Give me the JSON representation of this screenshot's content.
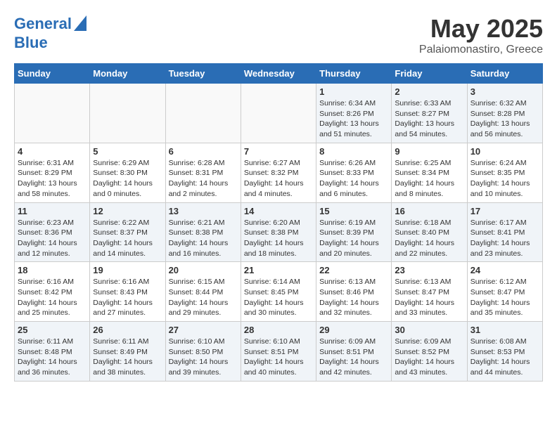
{
  "header": {
    "logo_line1": "General",
    "logo_line2": "Blue",
    "title": "May 2025",
    "subtitle": "Palaiomonastiro, Greece"
  },
  "days_of_week": [
    "Sunday",
    "Monday",
    "Tuesday",
    "Wednesday",
    "Thursday",
    "Friday",
    "Saturday"
  ],
  "weeks": [
    [
      {
        "day": "",
        "detail": ""
      },
      {
        "day": "",
        "detail": ""
      },
      {
        "day": "",
        "detail": ""
      },
      {
        "day": "",
        "detail": ""
      },
      {
        "day": "1",
        "detail": "Sunrise: 6:34 AM\nSunset: 8:26 PM\nDaylight: 13 hours and 51 minutes."
      },
      {
        "day": "2",
        "detail": "Sunrise: 6:33 AM\nSunset: 8:27 PM\nDaylight: 13 hours and 54 minutes."
      },
      {
        "day": "3",
        "detail": "Sunrise: 6:32 AM\nSunset: 8:28 PM\nDaylight: 13 hours and 56 minutes."
      }
    ],
    [
      {
        "day": "4",
        "detail": "Sunrise: 6:31 AM\nSunset: 8:29 PM\nDaylight: 13 hours and 58 minutes."
      },
      {
        "day": "5",
        "detail": "Sunrise: 6:29 AM\nSunset: 8:30 PM\nDaylight: 14 hours and 0 minutes."
      },
      {
        "day": "6",
        "detail": "Sunrise: 6:28 AM\nSunset: 8:31 PM\nDaylight: 14 hours and 2 minutes."
      },
      {
        "day": "7",
        "detail": "Sunrise: 6:27 AM\nSunset: 8:32 PM\nDaylight: 14 hours and 4 minutes."
      },
      {
        "day": "8",
        "detail": "Sunrise: 6:26 AM\nSunset: 8:33 PM\nDaylight: 14 hours and 6 minutes."
      },
      {
        "day": "9",
        "detail": "Sunrise: 6:25 AM\nSunset: 8:34 PM\nDaylight: 14 hours and 8 minutes."
      },
      {
        "day": "10",
        "detail": "Sunrise: 6:24 AM\nSunset: 8:35 PM\nDaylight: 14 hours and 10 minutes."
      }
    ],
    [
      {
        "day": "11",
        "detail": "Sunrise: 6:23 AM\nSunset: 8:36 PM\nDaylight: 14 hours and 12 minutes."
      },
      {
        "day": "12",
        "detail": "Sunrise: 6:22 AM\nSunset: 8:37 PM\nDaylight: 14 hours and 14 minutes."
      },
      {
        "day": "13",
        "detail": "Sunrise: 6:21 AM\nSunset: 8:38 PM\nDaylight: 14 hours and 16 minutes."
      },
      {
        "day": "14",
        "detail": "Sunrise: 6:20 AM\nSunset: 8:38 PM\nDaylight: 14 hours and 18 minutes."
      },
      {
        "day": "15",
        "detail": "Sunrise: 6:19 AM\nSunset: 8:39 PM\nDaylight: 14 hours and 20 minutes."
      },
      {
        "day": "16",
        "detail": "Sunrise: 6:18 AM\nSunset: 8:40 PM\nDaylight: 14 hours and 22 minutes."
      },
      {
        "day": "17",
        "detail": "Sunrise: 6:17 AM\nSunset: 8:41 PM\nDaylight: 14 hours and 23 minutes."
      }
    ],
    [
      {
        "day": "18",
        "detail": "Sunrise: 6:16 AM\nSunset: 8:42 PM\nDaylight: 14 hours and 25 minutes."
      },
      {
        "day": "19",
        "detail": "Sunrise: 6:16 AM\nSunset: 8:43 PM\nDaylight: 14 hours and 27 minutes."
      },
      {
        "day": "20",
        "detail": "Sunrise: 6:15 AM\nSunset: 8:44 PM\nDaylight: 14 hours and 29 minutes."
      },
      {
        "day": "21",
        "detail": "Sunrise: 6:14 AM\nSunset: 8:45 PM\nDaylight: 14 hours and 30 minutes."
      },
      {
        "day": "22",
        "detail": "Sunrise: 6:13 AM\nSunset: 8:46 PM\nDaylight: 14 hours and 32 minutes."
      },
      {
        "day": "23",
        "detail": "Sunrise: 6:13 AM\nSunset: 8:47 PM\nDaylight: 14 hours and 33 minutes."
      },
      {
        "day": "24",
        "detail": "Sunrise: 6:12 AM\nSunset: 8:47 PM\nDaylight: 14 hours and 35 minutes."
      }
    ],
    [
      {
        "day": "25",
        "detail": "Sunrise: 6:11 AM\nSunset: 8:48 PM\nDaylight: 14 hours and 36 minutes."
      },
      {
        "day": "26",
        "detail": "Sunrise: 6:11 AM\nSunset: 8:49 PM\nDaylight: 14 hours and 38 minutes."
      },
      {
        "day": "27",
        "detail": "Sunrise: 6:10 AM\nSunset: 8:50 PM\nDaylight: 14 hours and 39 minutes."
      },
      {
        "day": "28",
        "detail": "Sunrise: 6:10 AM\nSunset: 8:51 PM\nDaylight: 14 hours and 40 minutes."
      },
      {
        "day": "29",
        "detail": "Sunrise: 6:09 AM\nSunset: 8:51 PM\nDaylight: 14 hours and 42 minutes."
      },
      {
        "day": "30",
        "detail": "Sunrise: 6:09 AM\nSunset: 8:52 PM\nDaylight: 14 hours and 43 minutes."
      },
      {
        "day": "31",
        "detail": "Sunrise: 6:08 AM\nSunset: 8:53 PM\nDaylight: 14 hours and 44 minutes."
      }
    ]
  ]
}
